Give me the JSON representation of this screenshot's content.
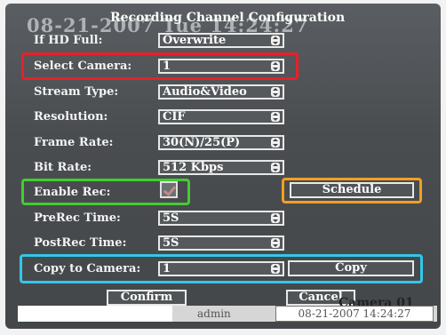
{
  "osd": {
    "timestamp": "08-21-2007 Tue 14:24:27",
    "camera": "Camera 01"
  },
  "dialog": {
    "title": "Recording Channel Configuration",
    "fields": [
      {
        "label": "If HD Full:",
        "value": "Overwrite"
      },
      {
        "label": "Select Camera:",
        "value": "1"
      },
      {
        "label": "Stream Type:",
        "value": "Audio&Video"
      },
      {
        "label": "Resolution:",
        "value": "CIF"
      },
      {
        "label": "Frame Rate:",
        "value": "30(N)/25(P)"
      },
      {
        "label": "Bit Rate:",
        "value": "512 Kbps"
      }
    ],
    "enable_rec": {
      "label": "Enable Rec:",
      "checked": true
    },
    "schedule_label": "Schedule",
    "prerec": {
      "label": "PreRec Time:",
      "value": "5S"
    },
    "postrec": {
      "label": "PostRec Time:",
      "value": "5S"
    },
    "copy_to": {
      "label": "Copy to Camera:",
      "value": "1",
      "button": "Copy"
    },
    "confirm_label": "Confirm",
    "cancel_label": "Cancel"
  },
  "statusbar": {
    "user": "admin",
    "time": "08-21-2007 14:24:27"
  },
  "highlight_colors": {
    "select_camera": "#e8202a",
    "enable_rec": "#44cc33",
    "schedule": "#f0a020",
    "copy": "#30c8e8"
  }
}
